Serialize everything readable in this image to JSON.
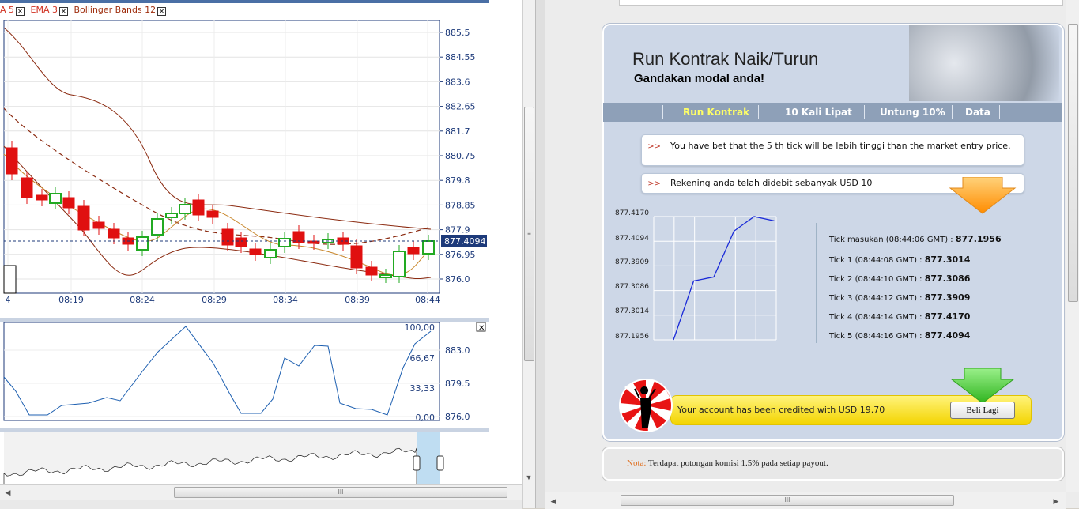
{
  "left_chart": {
    "legend": [
      {
        "label": "A 5",
        "color": "#d03020"
      },
      {
        "label": "EMA 3",
        "color": "#d03020"
      },
      {
        "label": "Bollinger Bands 12",
        "color": "#a03010"
      }
    ],
    "close_glyph": "☒",
    "price_ticks": [
      "885.5",
      "884.55",
      "883.6",
      "882.65",
      "881.7",
      "880.75",
      "879.8",
      "878.85",
      "877.9",
      "876.95",
      "876.0"
    ],
    "current_price": "877.4094",
    "time_ticks": [
      "4",
      "08:19",
      "08:24",
      "08:29",
      "08:34",
      "08:39",
      "08:44"
    ],
    "oscillator_ticks": [
      "100,00",
      "66,67",
      "33,33",
      "0,00"
    ],
    "oscillator_price_ticks": [
      "883.0",
      "879.5",
      "876.0"
    ],
    "colors": {
      "up": "#22aa22",
      "down": "#e01010",
      "band": "#8b2a10",
      "oscillator": "#1d5fb0",
      "price_line": "#1d3a7a"
    }
  },
  "right": {
    "title": "Run Kontrak Naik/Turun",
    "subtitle": "Gandakan modal anda!",
    "nav": [
      "Run Kontrak",
      "10 Kali Lipat",
      "Untung 10%",
      "Data"
    ],
    "nav_active_color": "#ffff66",
    "msg1": "You have bet that the 5 th tick will be lebih tinggi than the market entry price.",
    "msg2": "Rekening anda telah didebit sebanyak USD 10",
    "chev": ">>",
    "mini_chart": {
      "y_labels": [
        "877.4170",
        "877.4094",
        "877.3909",
        "877.3086",
        "877.3014",
        "877.1956"
      ],
      "values": [
        877.1956,
        877.3014,
        877.3086,
        877.3909,
        877.417,
        877.4094
      ]
    },
    "ticks": [
      {
        "label": "Tick masukan  (08:44:06 GMT) : ",
        "value": "877.1956"
      },
      {
        "label": "Tick 1 (08:44:08 GMT) : ",
        "value": "877.3014"
      },
      {
        "label": "Tick 2 (08:44:10 GMT) : ",
        "value": "877.3086"
      },
      {
        "label": "Tick 3 (08:44:12 GMT) : ",
        "value": "877.3909"
      },
      {
        "label": "Tick 4 (08:44:14 GMT) : ",
        "value": "877.4170"
      },
      {
        "label": "Tick 5 (08:44:16 GMT) : ",
        "value": "877.4094"
      }
    ],
    "credit_msg": "Your account has been credited with USD 19.70",
    "button": "Beli Lagi",
    "nota_label": "Nota:",
    "nota_text": " Terdapat potongan komisi 1.5% pada setiap payout.",
    "colors": {
      "panel": "#cdd7e7",
      "nav": "#8ea0b8",
      "credit": "#f3d400",
      "arrow_orange": "#ff9a1a",
      "arrow_green": "#3bc12a"
    }
  },
  "scroll_glyph": "III"
}
